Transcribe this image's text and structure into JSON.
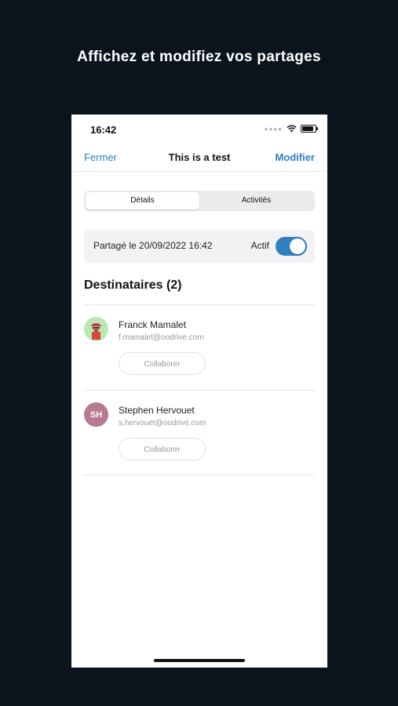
{
  "headline": "Affichez et modifiez vos partages",
  "status_bar": {
    "time": "16:42"
  },
  "nav": {
    "left": "Fermer",
    "title": "This is a test",
    "right": "Modifier"
  },
  "segments": [
    {
      "label": "Détails",
      "active": true
    },
    {
      "label": "Activités",
      "active": false
    }
  ],
  "share": {
    "shared_text": "Partagé le 20/09/2022 16:42",
    "toggle_label": "Actif",
    "toggle_on": true
  },
  "recipients_title": "Destinataires (2)",
  "recipients": [
    {
      "name": "Franck Mamalet",
      "email": "f.mamalet@oodrive.com",
      "button": "Collaborer",
      "avatar": "illustrated-avatar"
    },
    {
      "name": "Stephen Hervouet",
      "email": "s.hervouet@oodrive.com",
      "button": "Collaborer",
      "initials": "SH"
    }
  ],
  "colors": {
    "background": "#0b141c",
    "accent": "#2f7fc1",
    "avatar_sh": "#b67a92"
  }
}
